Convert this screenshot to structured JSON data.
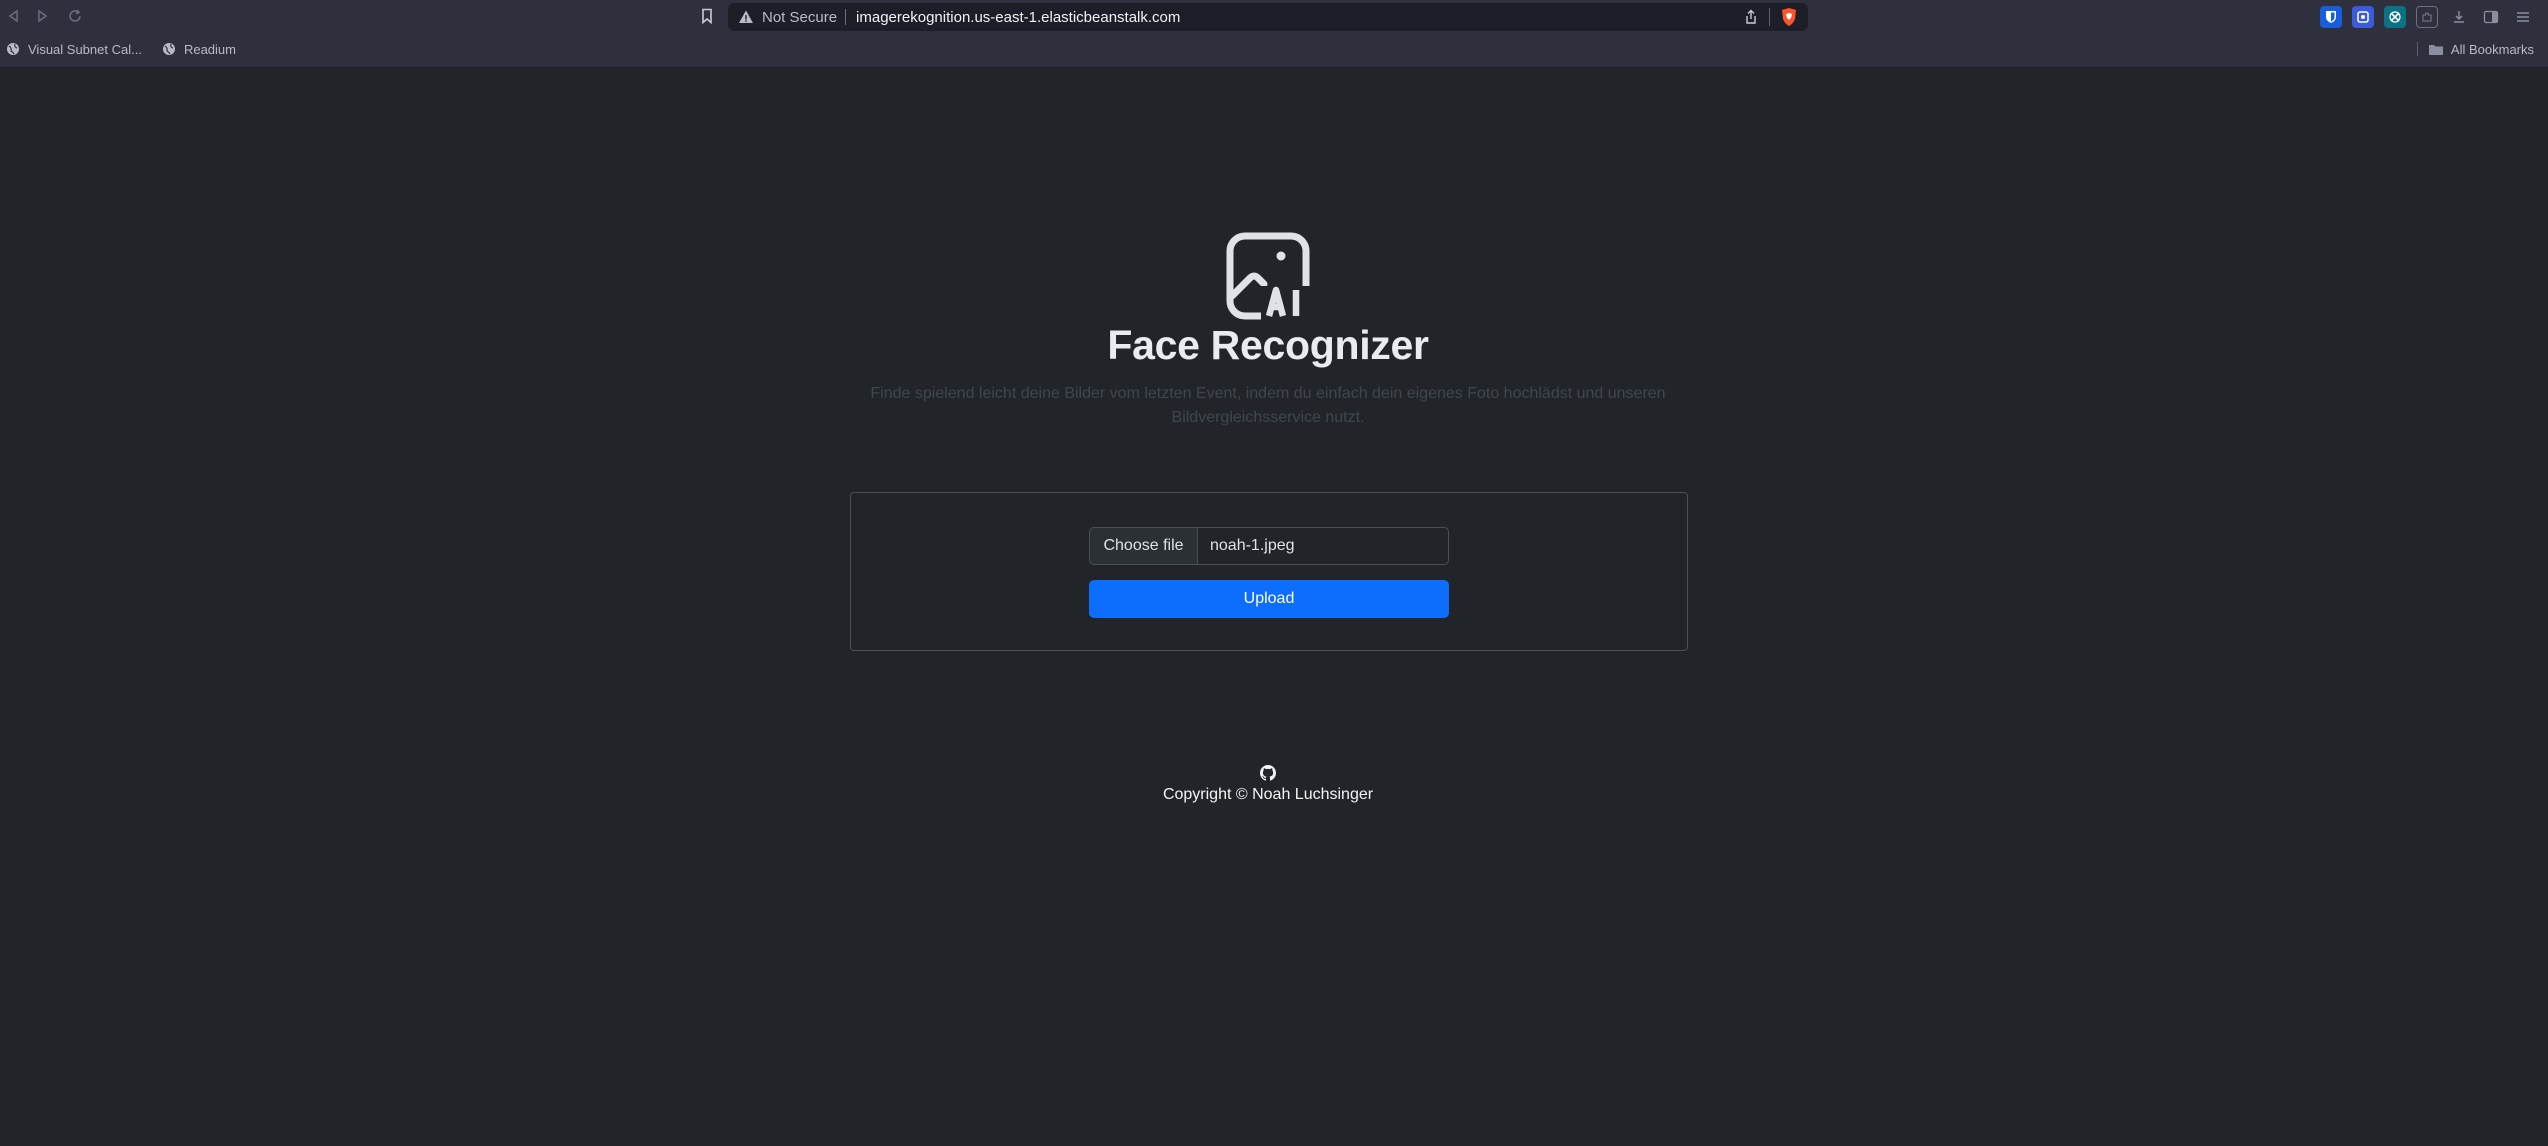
{
  "browser": {
    "address": {
      "security_label": "Not Secure",
      "url": "imagerekognition.us-east-1.elasticbeanstalk.com"
    },
    "bookmarks": [
      {
        "label": "Visual Subnet Cal...",
        "icon": "globe-icon"
      },
      {
        "label": "Readium",
        "icon": "globe-icon"
      }
    ],
    "all_bookmarks_label": "All Bookmarks",
    "extensions": [
      "bitwarden-icon",
      "extension-icon",
      "extension-icon",
      "puzzle-icon",
      "download-icon",
      "sidebar-icon",
      "menu-icon"
    ]
  },
  "page": {
    "title": "Face Recognizer",
    "description": "Finde spielend leicht deine Bilder vom letzten Event, indem du einfach dein eigenes Foto hochlädst und unseren Bildvergleichsservice nutzt.",
    "logo_icon": "image-ai-icon"
  },
  "upload_form": {
    "choose_label": "Choose file",
    "file_name": "noah-1.jpeg",
    "upload_label": "Upload"
  },
  "footer": {
    "icon": "github-icon",
    "copyright": "Copyright © Noah Luchsinger"
  },
  "colors": {
    "background": "#212529",
    "primary": "#0d6efd",
    "chrome": "#2e303e"
  }
}
